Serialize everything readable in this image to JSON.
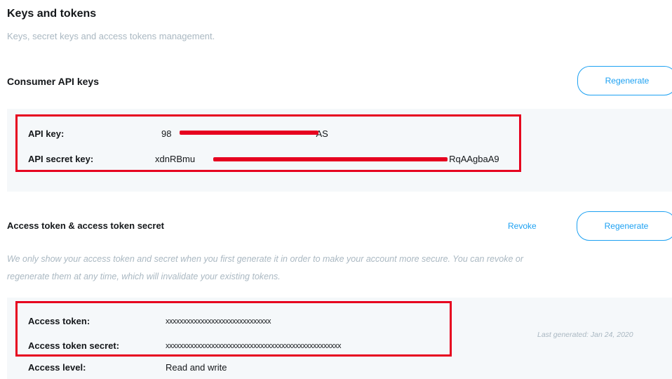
{
  "header": {
    "title": "Keys and tokens",
    "subtitle": "Keys, secret keys and access tokens management."
  },
  "consumer": {
    "heading": "Consumer API keys",
    "regenerate_label": "Regenerate",
    "api_key_label": "API key:",
    "api_key_prefix": "98",
    "api_key_suffix": "AS",
    "api_secret_label": "API secret key:",
    "api_secret_prefix": "xdnRBmu",
    "api_secret_suffix": "RqAAgbaA9"
  },
  "access": {
    "heading": "Access token & access token secret",
    "revoke_label": "Revoke",
    "regenerate_label": "Regenerate",
    "info_line1": "We only show your access token and secret when you first generate it in order to make your account more secure. You can revoke or",
    "info_line2": "regenerate them at any time, which will invalidate your existing tokens.",
    "token_label": "Access token:",
    "token_value": "xxxxxxxxxxxxxxxxxxxxxxxxxxxxxx",
    "secret_label": "Access token secret:",
    "secret_value": "xxxxxxxxxxxxxxxxxxxxxxxxxxxxxxxxxxxxxxxxxxxxxxxxxx",
    "level_label": "Access level:",
    "level_value": "Read and write",
    "last_generated": "Last generated: Jan 24, 2020"
  },
  "colors": {
    "accent": "#1da1f2",
    "redaction": "#e6001f",
    "panel_bg": "#f5f8fa",
    "muted_text": "#aab8c2"
  }
}
